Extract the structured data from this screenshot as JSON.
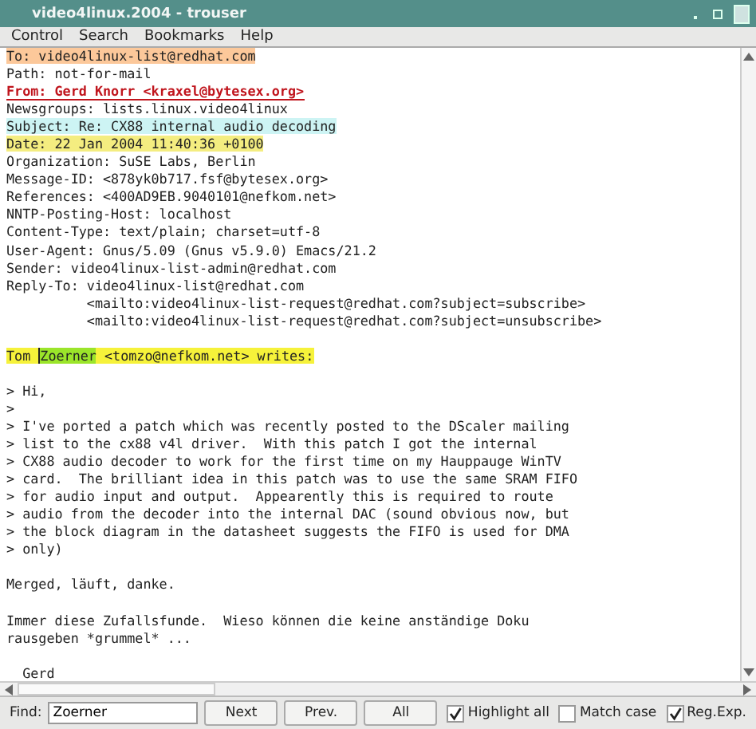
{
  "window": {
    "title": "video4linux.2004 - trouser"
  },
  "menu": [
    "Control",
    "Search",
    "Bookmarks",
    "Help"
  ],
  "lines": [
    {
      "kind": "to",
      "text": "To: video4linux-list@redhat.com"
    },
    {
      "kind": "plain",
      "text": "Path: not-for-mail"
    },
    {
      "kind": "from",
      "text": "From: Gerd Knorr <kraxel@bytesex.org>"
    },
    {
      "kind": "plain",
      "text": "Newsgroups: lists.linux.video4linux"
    },
    {
      "kind": "subject",
      "text": "Subject: Re: CX88 internal audio decoding"
    },
    {
      "kind": "date",
      "text": "Date: 22 Jan 2004 11:40:36 +0100"
    },
    {
      "kind": "plain",
      "text": "Organization: SuSE Labs, Berlin"
    },
    {
      "kind": "plain",
      "text": "Message-ID: <878yk0b717.fsf@bytesex.org>"
    },
    {
      "kind": "plain",
      "text": "References: <400AD9EB.9040101@nefkom.net>"
    },
    {
      "kind": "plain",
      "text": "NNTP-Posting-Host: localhost"
    },
    {
      "kind": "plain",
      "text": "Content-Type: text/plain; charset=utf-8"
    },
    {
      "kind": "plain",
      "text": "User-Agent: Gnus/5.09 (Gnus v5.9.0) Emacs/21.2"
    },
    {
      "kind": "plain",
      "text": "Sender: video4linux-list-admin@redhat.com"
    },
    {
      "kind": "plain",
      "text": "Reply-To: video4linux-list@redhat.com"
    },
    {
      "kind": "plain",
      "text": "          <mailto:video4linux-list-request@redhat.com?subject=subscribe>"
    },
    {
      "kind": "plain",
      "text": "          <mailto:video4linux-list-request@redhat.com?subject=unsubscribe>"
    },
    {
      "kind": "blank"
    },
    {
      "kind": "attribution",
      "before": "Tom ",
      "match": "Zoerner",
      "after": " <tomzo@nefkom.net> writes:"
    },
    {
      "kind": "blank"
    },
    {
      "kind": "plain",
      "text": "> Hi,"
    },
    {
      "kind": "plain",
      "text": ">"
    },
    {
      "kind": "plain",
      "text": "> I've ported a patch which was recently posted to the DScaler mailing"
    },
    {
      "kind": "plain",
      "text": "> list to the cx88 v4l driver.  With this patch I got the internal"
    },
    {
      "kind": "plain",
      "text": "> CX88 audio decoder to work for the first time on my Hauppauge WinTV"
    },
    {
      "kind": "plain",
      "text": "> card.  The brilliant idea in this patch was to use the same SRAM FIFO"
    },
    {
      "kind": "plain",
      "text": "> for audio input and output.  Appearently this is required to route"
    },
    {
      "kind": "plain",
      "text": "> audio from the decoder into the internal DAC (sound obvious now, but"
    },
    {
      "kind": "plain",
      "text": "> the block diagram in the datasheet suggests the FIFO is used for DMA"
    },
    {
      "kind": "plain",
      "text": "> only)"
    },
    {
      "kind": "blank"
    },
    {
      "kind": "plain",
      "text": "Merged, läuft, danke."
    },
    {
      "kind": "blank"
    },
    {
      "kind": "plain",
      "text": "Immer diese Zufallsfunde.  Wieso können die keine anständige Doku"
    },
    {
      "kind": "plain",
      "text": "rausgeben *grummel* ..."
    },
    {
      "kind": "blank"
    },
    {
      "kind": "plain",
      "text": "  Gerd"
    }
  ],
  "find": {
    "label": "Find:",
    "value": "Zoerner",
    "buttons": [
      "Next",
      "Prev.",
      "All"
    ],
    "options": [
      {
        "label": "Highlight all",
        "checked": true
      },
      {
        "label": "Match case",
        "checked": false
      },
      {
        "label": "Reg.Exp.",
        "checked": true
      }
    ]
  }
}
